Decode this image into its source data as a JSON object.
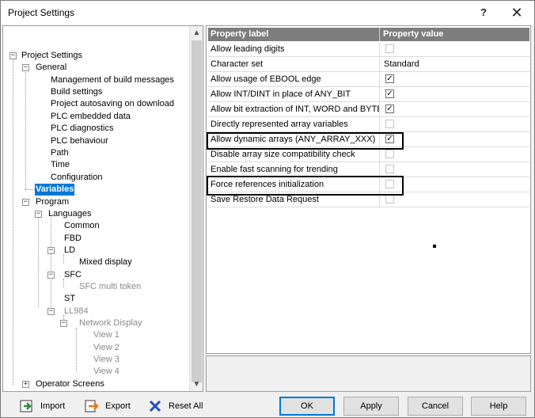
{
  "window": {
    "title": "Project Settings",
    "help_label": "?",
    "close_label": "✕"
  },
  "tree": {
    "root": "Project Settings",
    "general": "General",
    "general_items": [
      "Management of build messages",
      "Build settings",
      "Project autosaving on download",
      "PLC embedded data",
      "PLC diagnostics",
      "PLC behaviour",
      "Path",
      "Time",
      "Configuration"
    ],
    "variables": "Variables",
    "program": "Program",
    "languages": "Languages",
    "common": "Common",
    "fbd": "FBD",
    "ld": "LD",
    "mixed_display": "Mixed display",
    "sfc": "SFC",
    "sfc_multi_token": "SFC multi token",
    "st": "ST",
    "ll984": "LL984",
    "network_display": "Network Display",
    "views": [
      "View 1",
      "View 2",
      "View 3",
      "View 4"
    ],
    "operator_screens": "Operator Screens",
    "toggle_minus": "−",
    "toggle_plus": "+",
    "scroll_up": "▲",
    "scroll_down": "▼"
  },
  "grid": {
    "col_label": "Property label",
    "col_value": "Property value",
    "rows": [
      {
        "label": "Allow leading digits",
        "checked": false,
        "dim": false
      },
      {
        "label": "Character set",
        "value": "Standard"
      },
      {
        "label": "Allow usage of EBOOL edge",
        "checked": true,
        "dim": false
      },
      {
        "label": "Allow INT/DINT in place of ANY_BIT",
        "checked": true,
        "dim": false
      },
      {
        "label": "Allow bit extraction of INT, WORD and BYTE",
        "checked": true,
        "dim": false
      },
      {
        "label": "Directly represented array variables",
        "checked": false,
        "dim": true
      },
      {
        "label": "Allow dynamic arrays (ANY_ARRAY_XXX)",
        "checked": true,
        "dim": false
      },
      {
        "label": "Disable array size compatibility check",
        "checked": false,
        "dim": true
      },
      {
        "label": "Enable fast scanning for trending",
        "checked": false,
        "dim": true
      },
      {
        "label": "Force references initialization",
        "checked": false,
        "dim": true
      },
      {
        "label": "Save Restore Data Request",
        "checked": false,
        "dim": true
      }
    ],
    "check_mark": "✓"
  },
  "toolbar": {
    "import_label": "Import",
    "export_label": "Export",
    "reset_label": "Reset All"
  },
  "buttons": {
    "ok": "OK",
    "apply": "Apply",
    "cancel": "Cancel",
    "help": "Help"
  },
  "colors": {
    "selection": "#0078d7",
    "header_bg": "#7d7d7d",
    "import_icon": "#2e8b3c",
    "export_icon": "#e07a1f",
    "reset_icon": "#1f4fbf"
  }
}
